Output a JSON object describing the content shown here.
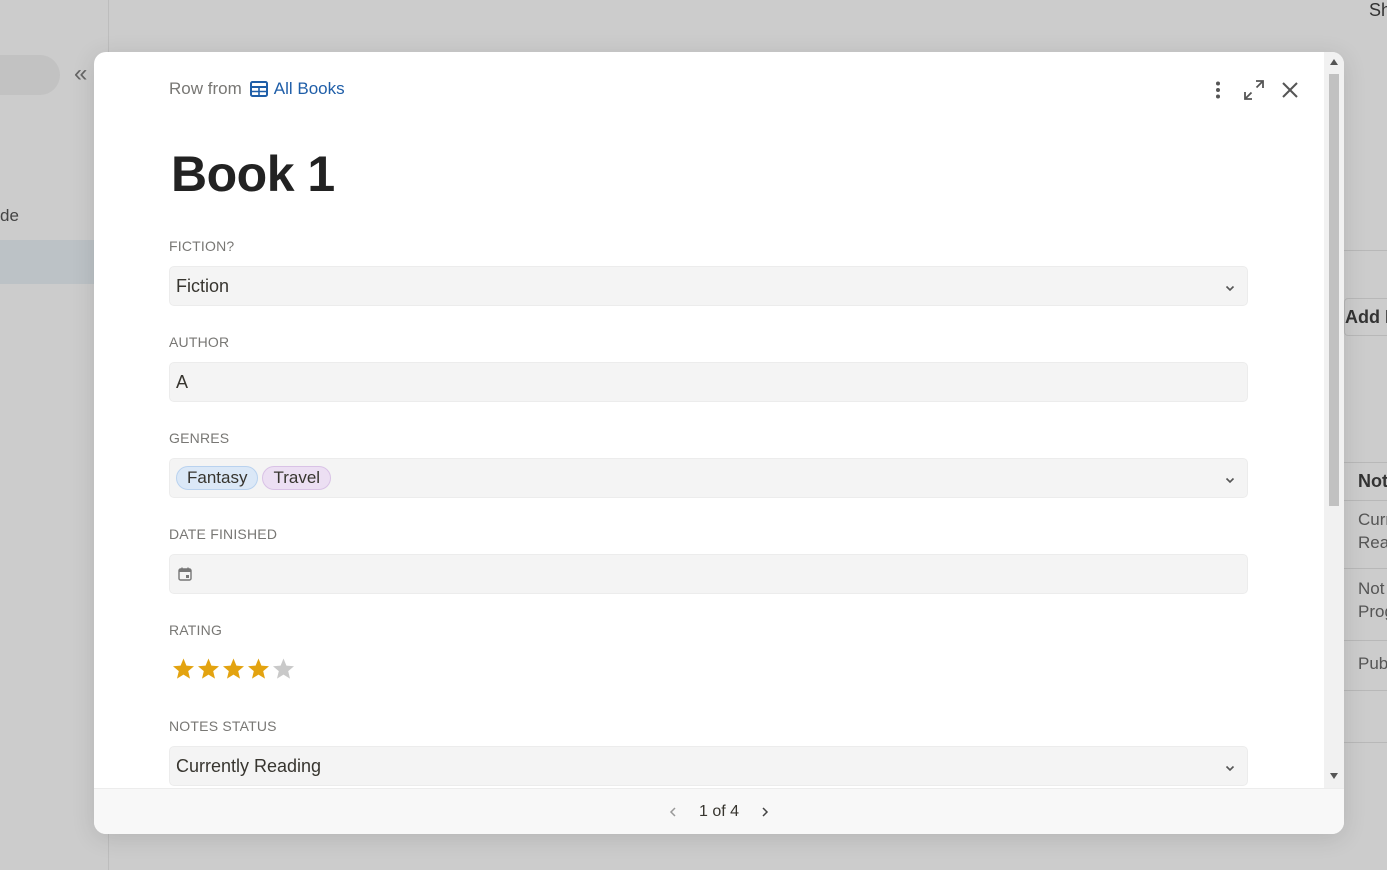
{
  "background": {
    "top_right_text": "Sh",
    "sidebar_text": "de",
    "right_panel": {
      "add_text": "Add N",
      "column_header": "Not",
      "row1_line1": "Curr",
      "row1_line2": "Rea",
      "row2_line1": "Not",
      "row2_line2": "Prog",
      "row3": "Pub"
    }
  },
  "modal": {
    "breadcrumb": {
      "prefix": "Row from",
      "table_icon": "table-icon",
      "link": "All Books"
    },
    "actions": {
      "more": "more-vertical-icon",
      "expand": "expand-icon",
      "close": "close-icon"
    },
    "title": "Book 1",
    "fields": {
      "fiction": {
        "label": "FICTION?",
        "value": "Fiction"
      },
      "author": {
        "label": "AUTHOR",
        "value": "A"
      },
      "genres": {
        "label": "GENRES",
        "tags": [
          "Fantasy",
          "Travel"
        ]
      },
      "date_finished": {
        "label": "DATE FINISHED",
        "value": "",
        "icon": "calendar-icon"
      },
      "rating": {
        "label": "RATING",
        "value": 4,
        "max": 5,
        "color": "#e3a310"
      },
      "notes_status": {
        "label": "NOTES STATUS",
        "value": "Currently Reading"
      }
    },
    "pagination": {
      "text": "1 of 4"
    }
  }
}
